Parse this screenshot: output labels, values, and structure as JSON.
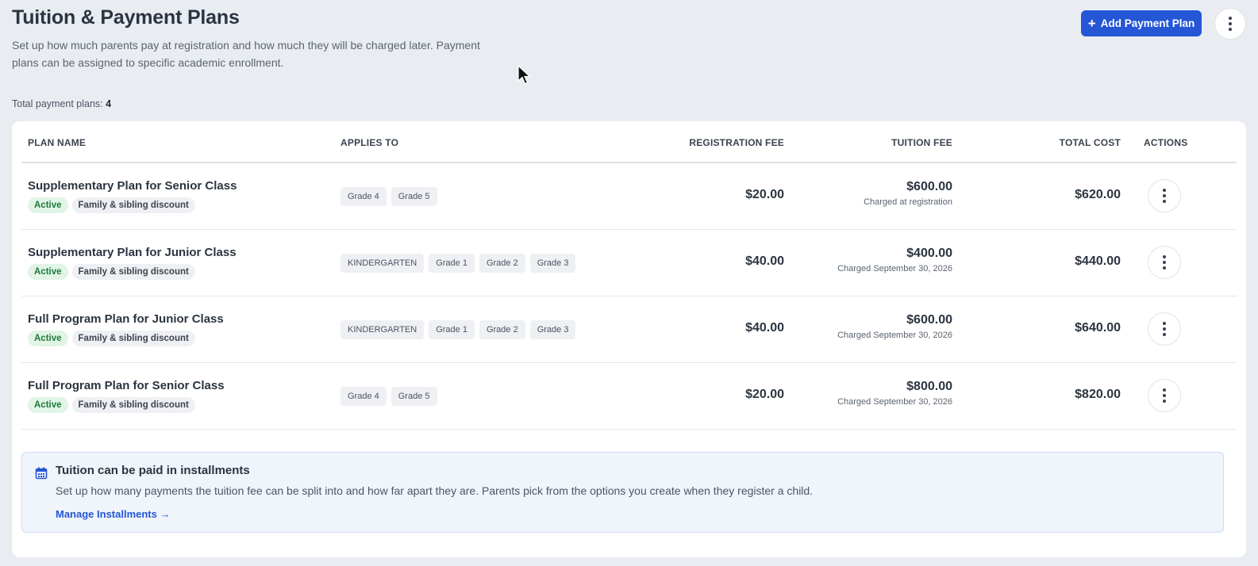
{
  "header": {
    "title": "Tuition & Payment Plans",
    "description": "Set up how much parents pay at registration and how much they will be charged later. Payment plans can be assigned to specific academic enrollment.",
    "add_button_label": "Add Payment Plan",
    "add_button_icon": "plus-icon",
    "more_icon": "kebab-vertical-icon"
  },
  "summary": {
    "label": "Total payment plans:",
    "count": "4"
  },
  "table": {
    "columns": {
      "plan_name": "PLAN NAME",
      "applies_to": "APPLIES TO",
      "registration_fee": "REGISTRATION FEE",
      "tuition_fee": "TUITION FEE",
      "total_cost": "TOTAL COST",
      "actions": "ACTIONS"
    },
    "rows": [
      {
        "name": "Supplementary Plan for Senior Class",
        "status": "Active",
        "discount": "Family & sibling discount",
        "applies_to": [
          "Grade 4",
          "Grade 5"
        ],
        "registration_fee": "$20.00",
        "tuition_fee": "$600.00",
        "tuition_note": "Charged at registration",
        "total_cost": "$620.00"
      },
      {
        "name": "Supplementary Plan for Junior Class",
        "status": "Active",
        "discount": "Family & sibling discount",
        "applies_to": [
          "KINDERGARTEN",
          "Grade 1",
          "Grade 2",
          "Grade 3"
        ],
        "registration_fee": "$40.00",
        "tuition_fee": "$400.00",
        "tuition_note": "Charged September 30, 2026",
        "total_cost": "$440.00"
      },
      {
        "name": "Full Program Plan for Junior Class",
        "status": "Active",
        "discount": "Family & sibling discount",
        "applies_to": [
          "KINDERGARTEN",
          "Grade 1",
          "Grade 2",
          "Grade 3"
        ],
        "registration_fee": "$40.00",
        "tuition_fee": "$600.00",
        "tuition_note": "Charged September 30, 2026",
        "total_cost": "$640.00"
      },
      {
        "name": "Full Program Plan for Senior Class",
        "status": "Active",
        "discount": "Family & sibling discount",
        "applies_to": [
          "Grade 4",
          "Grade 5"
        ],
        "registration_fee": "$20.00",
        "tuition_fee": "$800.00",
        "tuition_note": "Charged September 30, 2026",
        "total_cost": "$820.00"
      }
    ]
  },
  "installments": {
    "icon": "calendar-icon",
    "title": "Tuition can be paid in installments",
    "text": "Set up how many payments the tuition fee can be split into and how far apart they are. Parents pick from the options you create when they register a child.",
    "link_label": "Manage Installments →"
  },
  "colors": {
    "primary": "#2456d6",
    "active_badge_bg": "#e1f4e6",
    "active_badge_text": "#1d7a3a",
    "background": "#e9edf2"
  }
}
